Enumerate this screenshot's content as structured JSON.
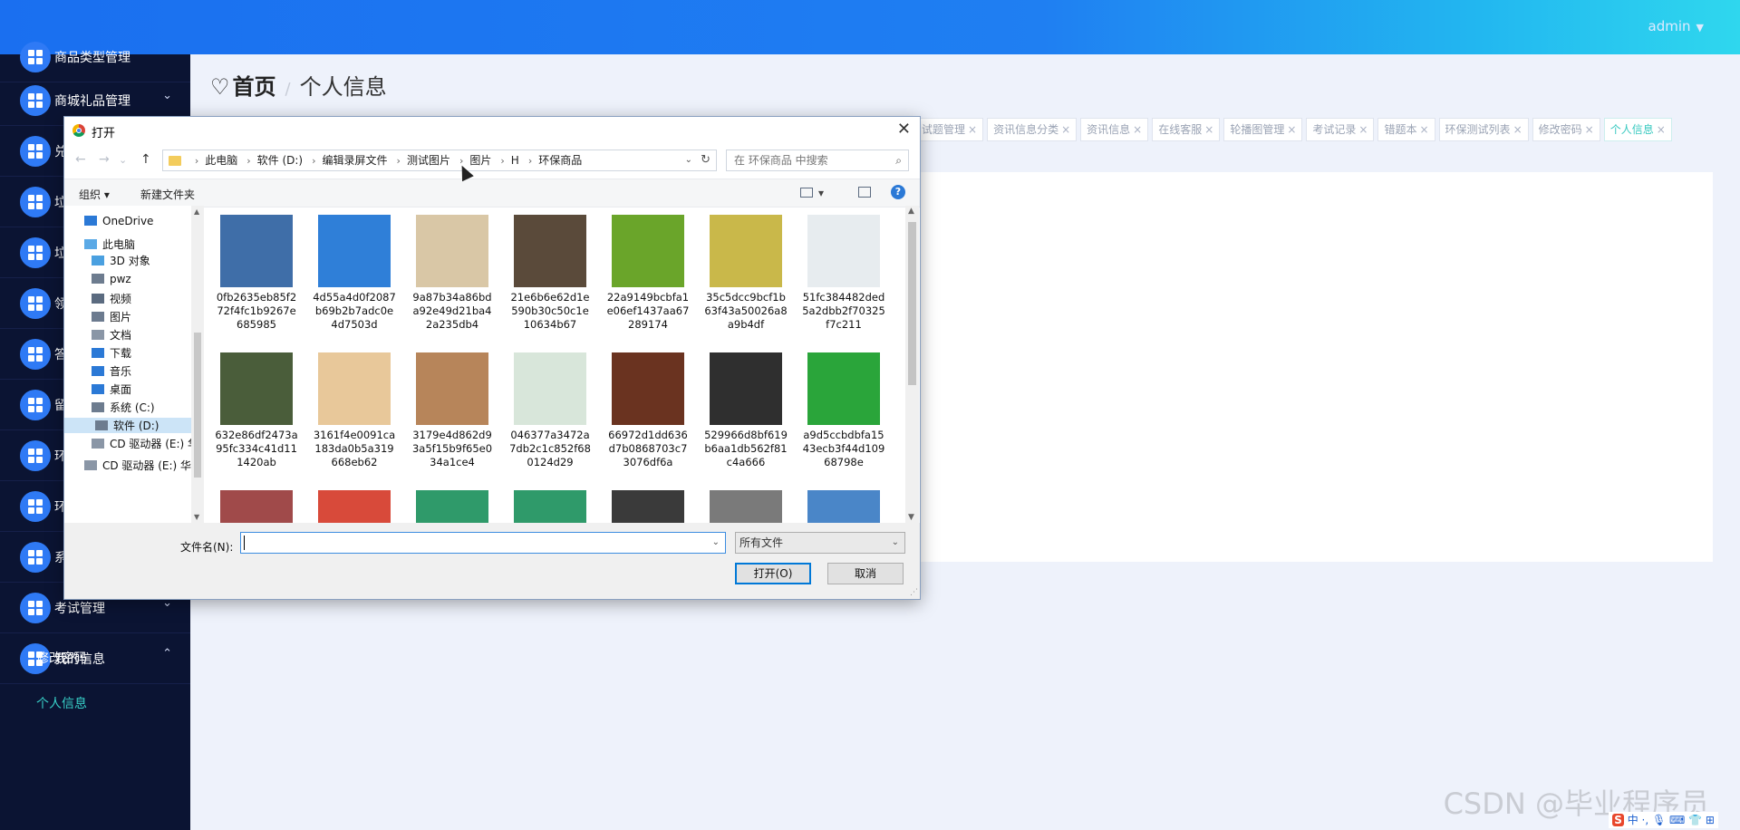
{
  "header": {
    "user_name": "admin",
    "user_caret": "▼"
  },
  "sidebar": {
    "items": [
      {
        "label": "商品类型管理",
        "chevron": ""
      },
      {
        "label": "商城礼品管理",
        "chevron": "⌄"
      },
      {
        "label": "兑",
        "chevron": "⌄"
      },
      {
        "label": "垃",
        "chevron": "⌄"
      },
      {
        "label": "垃",
        "chevron": "⌄"
      },
      {
        "label": "领",
        "chevron": "⌄"
      },
      {
        "label": "答",
        "chevron": "⌄"
      },
      {
        "label": "留",
        "chevron": "⌄"
      },
      {
        "label": "环",
        "chevron": "⌄"
      },
      {
        "label": "环",
        "chevron": "⌄"
      },
      {
        "label": "系",
        "chevron": "⌄"
      },
      {
        "label": "考试管理",
        "chevron": "⌄"
      },
      {
        "label": "我的信息",
        "chevron": "⌃"
      }
    ],
    "sub_items": [
      "修改密码",
      "个人信息"
    ]
  },
  "breadcrumb": {
    "heart": "♡",
    "home": "首页",
    "separator": "/",
    "current": "个人信息"
  },
  "tabs": [
    {
      "label": "试题管理",
      "close": "×",
      "active": false
    },
    {
      "label": "资讯信息分类",
      "close": "×",
      "active": false
    },
    {
      "label": "资讯信息",
      "close": "×",
      "active": false
    },
    {
      "label": "在线客服",
      "close": "×",
      "active": false
    },
    {
      "label": "轮播图管理",
      "close": "×",
      "active": false
    },
    {
      "label": "考试记录",
      "close": "×",
      "active": false
    },
    {
      "label": "错题本",
      "close": "×",
      "active": false
    },
    {
      "label": "环保测试列表",
      "close": "×",
      "active": false
    },
    {
      "label": "修改密码",
      "close": "×",
      "active": false
    },
    {
      "label": "个人信息",
      "close": "×",
      "active": true
    }
  ],
  "dialog": {
    "title": "打开",
    "close": "✕",
    "nav": {
      "back": "←",
      "forward": "→",
      "recent": "⌄",
      "up": "↑"
    },
    "address": {
      "segments": [
        "此电脑",
        "软件 (D:)",
        "编辑录屏文件",
        "测试图片",
        "图片",
        "H",
        "环保商品"
      ],
      "arrow": "›",
      "dropdown": "⌄",
      "refresh": "↻"
    },
    "search": {
      "placeholder": "在 环保商品 中搜索",
      "icon": "⌕"
    },
    "toolbar": {
      "organize": "组织 ▾",
      "new_folder": "新建文件夹",
      "view": "▾",
      "help": "?"
    },
    "nav_pane": [
      {
        "label": "OneDrive",
        "icon_color": "#2b79d6",
        "selected": false
      },
      {
        "label": "此电脑",
        "icon_color": "#5aa9e6",
        "selected": false
      },
      {
        "label": "3D 对象",
        "icon_color": "#4aa0e0",
        "selected": false
      },
      {
        "label": "pwz",
        "icon_color": "#6d7c8f",
        "selected": false
      },
      {
        "label": "视频",
        "icon_color": "#5b6b80",
        "selected": false
      },
      {
        "label": "图片",
        "icon_color": "#6c7b8f",
        "selected": false
      },
      {
        "label": "文档",
        "icon_color": "#8a96a6",
        "selected": false
      },
      {
        "label": "下载",
        "icon_color": "#2b79d6",
        "selected": false
      },
      {
        "label": "音乐",
        "icon_color": "#2b79d6",
        "selected": false
      },
      {
        "label": "桌面",
        "icon_color": "#2b79d6",
        "selected": false
      },
      {
        "label": "系统 (C:)",
        "icon_color": "#6d7c8f",
        "selected": false
      },
      {
        "label": "软件 (D:)",
        "icon_color": "#6d7c8f",
        "selected": true
      },
      {
        "label": "CD 驱动器 (E:) 华",
        "icon_color": "#8a96a6",
        "selected": false
      },
      {
        "label": "CD 驱动器 (E:) 华",
        "icon_color": "#8a96a6",
        "selected": false
      }
    ],
    "nav_pane_arrows": {
      "up": "▲",
      "down": "▼"
    },
    "files": [
      {
        "name": "0fb2635eb85f272f4fc1b9267e685985",
        "color": "#3f6ea8"
      },
      {
        "name": "4d55a4d0f2087b69b2b7adc0e4d7503d",
        "color": "#2f7fd8"
      },
      {
        "name": "9a87b34a86bda92e49d21ba42a235db4",
        "color": "#d9c7a6"
      },
      {
        "name": "21e6b6e62d1e590b30c50c1e10634b67",
        "color": "#5a4a3a"
      },
      {
        "name": "22a9149bcbfa1e06ef1437aa67289174",
        "color": "#6aa52a"
      },
      {
        "name": "35c5dcc9bcf1b63f43a50026a8a9b4df",
        "color": "#c9b84a"
      },
      {
        "name": "51fc384482ded5a2dbb2f70325f7c211",
        "color": "#e7ecef"
      },
      {
        "name": "632e86df2473a95fc334c41d111420ab",
        "color": "#4a5d3a"
      },
      {
        "name": "3161f4e0091ca183da0b5a319668eb62",
        "color": "#e8c89a"
      },
      {
        "name": "3179e4d862d93a5f15b9f65e034a1ce4",
        "color": "#b7855a"
      },
      {
        "name": "046377a3472a7db2c1c852f680124d29",
        "color": "#d8e6da"
      },
      {
        "name": "66972d1dd636d7b0868703c73076df6a",
        "color": "#6a3320"
      },
      {
        "name": "529966d8bf619b6aa1db562f81c4a666",
        "color": "#2f2f2f"
      },
      {
        "name": "a9d5ccbdbfa1543ecb3f44d10968798e",
        "color": "#2aa53a"
      },
      {
        "name": "",
        "color": "#a04a4a"
      },
      {
        "name": "",
        "color": "#d84a3a"
      },
      {
        "name": "",
        "color": "#2f9a6a"
      },
      {
        "name": "",
        "color": "#2f9a6a"
      },
      {
        "name": "",
        "color": "#3a3a3a"
      },
      {
        "name": "",
        "color": "#7a7a7a"
      },
      {
        "name": "",
        "color": "#4a86c8"
      }
    ],
    "scroll_arrows": {
      "up": "▲",
      "down": "▼"
    },
    "footer": {
      "filename_label": "文件名(N):",
      "filename_value": "",
      "filename_dropdown": "⌄",
      "filetype": "所有文件",
      "filetype_dropdown": "⌄",
      "open_button": "打开(O)",
      "cancel_button": "取消",
      "grip": "⋰"
    }
  },
  "watermark": "CSDN @毕业程序员",
  "ime": {
    "logo": "S",
    "items": "中 ·, 🎙 ⌨ 👕 ⊞"
  }
}
